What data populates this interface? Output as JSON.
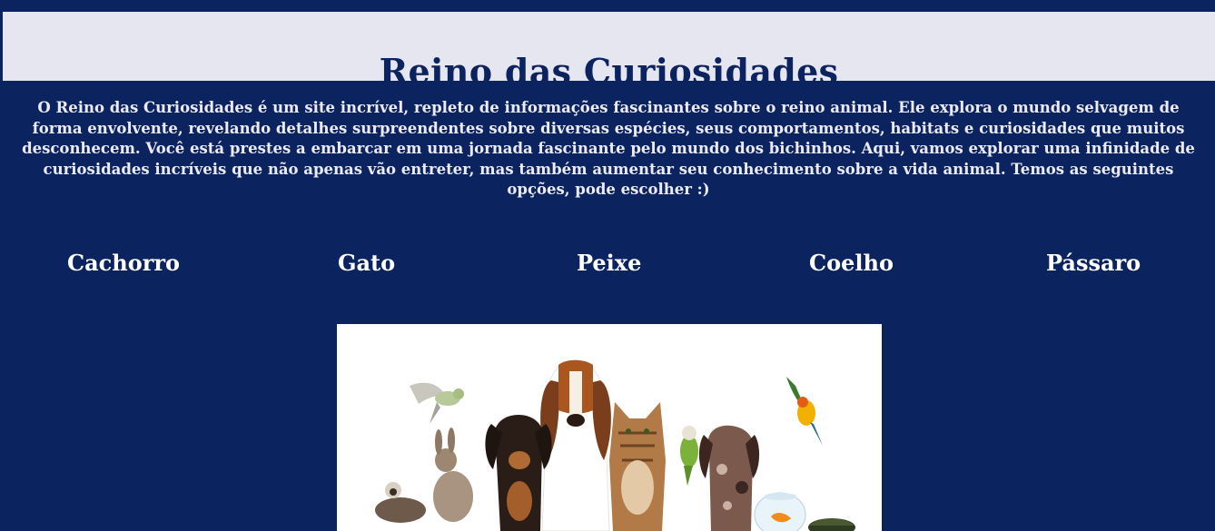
{
  "site": {
    "title": "Reino das Curiosidades",
    "intro": "O Reino das Curiosidades é um site incrível, repleto de informações fascinantes sobre o reino animal. Ele explora o mundo selvagem de forma envolvente, revelando detalhes surpreendentes sobre diversas espécies, seus comportamentos, habitats e curiosidades que muitos desconhecem. Você está prestes a embarcar em uma jornada fascinante pelo mundo dos bichinhos. Aqui, vamos explorar uma infinidade de curiosidades incríveis que não apenas vão entreter, mas também aumentar seu conhecimento sobre a vida animal. Temos as seguintes opções, pode escolher :)"
  },
  "nav": {
    "items": [
      {
        "label": "Cachorro"
      },
      {
        "label": "Gato"
      },
      {
        "label": "Peixe"
      },
      {
        "label": "Coelho"
      },
      {
        "label": "Pássaro"
      }
    ]
  },
  "colors": {
    "background": "#0b235f",
    "header_band": "#e6e6f0",
    "title_text": "#0b235f",
    "body_text": "#ecebf5"
  },
  "hero": {
    "image_content": "group-of-pets-photo"
  }
}
